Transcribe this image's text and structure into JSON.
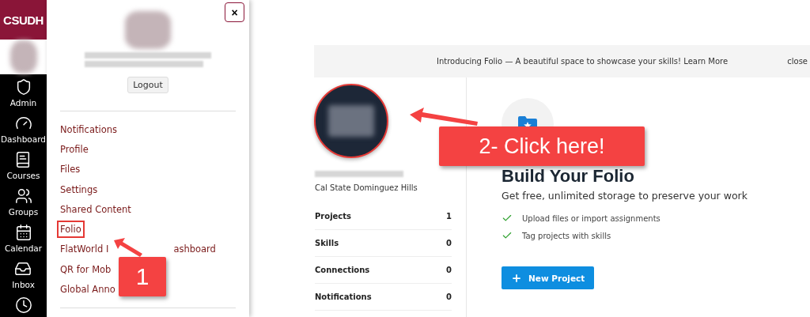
{
  "logo": {
    "text": "CSUDH"
  },
  "nav": [
    {
      "label": "Admin",
      "kind": "admin"
    },
    {
      "label": "Dashboard",
      "kind": "dashboard"
    },
    {
      "label": "Courses",
      "kind": "courses"
    },
    {
      "label": "Groups",
      "kind": "groups"
    },
    {
      "label": "Calendar",
      "kind": "calendar"
    },
    {
      "label": "Inbox",
      "kind": "inbox"
    },
    {
      "kind": "history"
    }
  ],
  "tray": {
    "close": "×",
    "logout": "Logout",
    "links": [
      {
        "text": "Notifications"
      },
      {
        "text": "Profile"
      },
      {
        "text": "Files"
      },
      {
        "text": "Settings"
      },
      {
        "text": "Shared Content"
      },
      {
        "text": "Folio",
        "highlighted": true
      },
      {
        "text": "FlatWorld I",
        "tail": "ashboard"
      },
      {
        "text": "QR for Mob"
      },
      {
        "text": "Global Anno"
      }
    ]
  },
  "banner": {
    "text": "Introducing Folio — A beautiful space to showcase your skills! Learn More",
    "close": "close"
  },
  "profile": {
    "school": "Cal State Dominguez Hills",
    "stats": [
      {
        "label": "Projects",
        "value": "1"
      },
      {
        "label": "Skills",
        "value": "0"
      },
      {
        "label": "Connections",
        "value": "0"
      },
      {
        "label": "Notifications",
        "value": "0"
      }
    ]
  },
  "folio": {
    "title": "Build Your Folio",
    "subtitle": "Get free, unlimited storage to preserve your work",
    "features": [
      "Upload files or import assignments",
      "Tag projects with skills"
    ],
    "button": "New Project"
  },
  "callouts": [
    {
      "text": "1"
    },
    {
      "text": "2- Click here!"
    }
  ]
}
